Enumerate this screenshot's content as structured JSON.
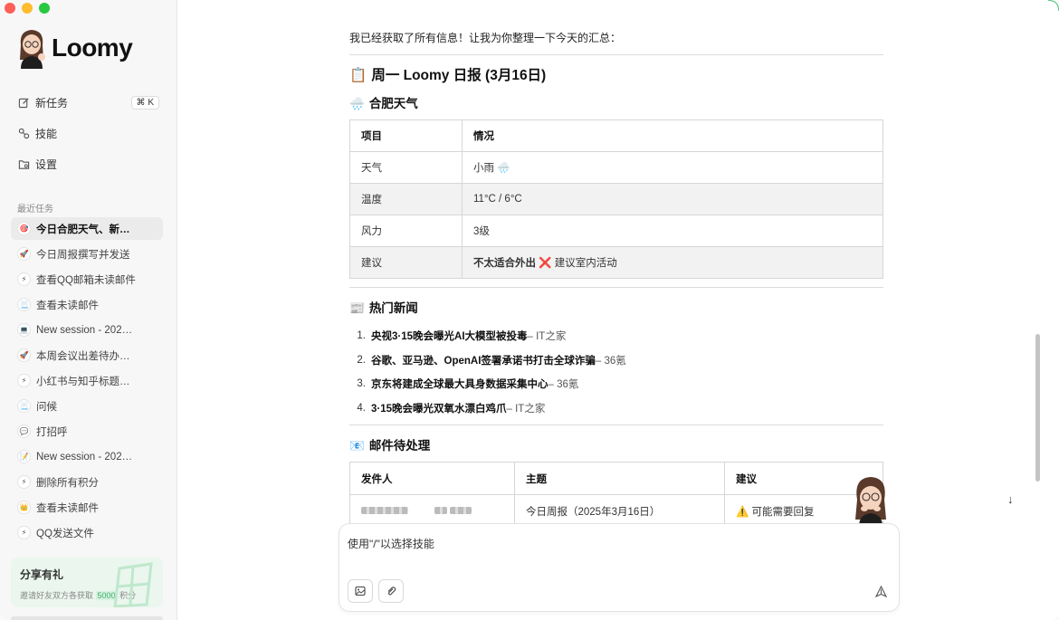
{
  "app": {
    "name": "Loomy"
  },
  "sidebar": {
    "nav": [
      {
        "label": "新任务",
        "icon": "edit-icon",
        "shortcut": "⌘ K"
      },
      {
        "label": "技能",
        "icon": "skills-icon"
      },
      {
        "label": "设置",
        "icon": "settings-folder-icon"
      }
    ],
    "recent_label": "最近任务",
    "recent": [
      {
        "label": "今日合肥天气、新…",
        "icon": "🎯"
      },
      {
        "label": "今日周报撰写并发送",
        "icon": "🚀"
      },
      {
        "label": "查看QQ邮箱未读邮件",
        "icon": "⚡"
      },
      {
        "label": "查看未读邮件",
        "icon": "📃"
      },
      {
        "label": "New session - 202…",
        "icon": "💻"
      },
      {
        "label": "本周会议出差待办…",
        "icon": "🚀"
      },
      {
        "label": "小红书与知乎标题…",
        "icon": "⚡"
      },
      {
        "label": "问候",
        "icon": "📃"
      },
      {
        "label": "打招呼",
        "icon": "💬"
      },
      {
        "label": "New session - 202…",
        "icon": "📝"
      },
      {
        "label": "删除所有积分",
        "icon": "⚡"
      },
      {
        "label": "查看未读邮件",
        "icon": "👑"
      },
      {
        "label": "QQ发送文件",
        "icon": "⚡"
      }
    ],
    "share": {
      "title": "分享有礼",
      "desc_prefix": "邀请好友双方各获取",
      "desc_highlight": "5000",
      "desc_suffix": "积分"
    }
  },
  "main": {
    "intro": "我已经获取了所有信息！让我为你整理一下今天的汇总：",
    "title_emoji": "📋",
    "title": "周一 Loomy 日报 (3月16日)",
    "weather": {
      "emoji": "🌧️",
      "heading": "合肥天气",
      "headers": [
        "项目",
        "情况"
      ],
      "rows": [
        {
          "k": "天气",
          "v": "小雨 🌧️"
        },
        {
          "k": "温度",
          "v": "11°C / 6°C"
        },
        {
          "k": "风力",
          "v": "3级"
        },
        {
          "k": "建议",
          "v_bold": "不太适合外出",
          "v_icon": "❌",
          "v_rest": " 建议室内活动"
        }
      ]
    },
    "news": {
      "emoji": "📰",
      "heading": "热门新闻",
      "items": [
        {
          "n": "1.",
          "title": "央视3·15晚会曝光AI大模型被投毒",
          "src": " – IT之家"
        },
        {
          "n": "2.",
          "title": "谷歌、亚马逊、OpenAI签署承诺书打击全球诈骗",
          "src": " – 36氪"
        },
        {
          "n": "3.",
          "title": "京东将建成全球最大具身数据采集中心",
          "src": " – 36氪"
        },
        {
          "n": "4.",
          "title": "3·15晚会曝光双氧水漂白鸡爪",
          "src": " – IT之家"
        }
      ]
    },
    "mail": {
      "emoji": "📧",
      "heading": "邮件待处理",
      "headers": [
        "发件人",
        "主题",
        "建议"
      ],
      "rows": [
        {
          "subject": "今日周报（2025年3月16日）",
          "advice_icon": "⚠️",
          "advice": "可能需要回复"
        }
      ]
    }
  },
  "composer": {
    "placeholder": "使用\"/\"以选择技能"
  },
  "colors": {
    "accent_green": "#3ab06b",
    "share_bg": "#eaf6ee"
  }
}
